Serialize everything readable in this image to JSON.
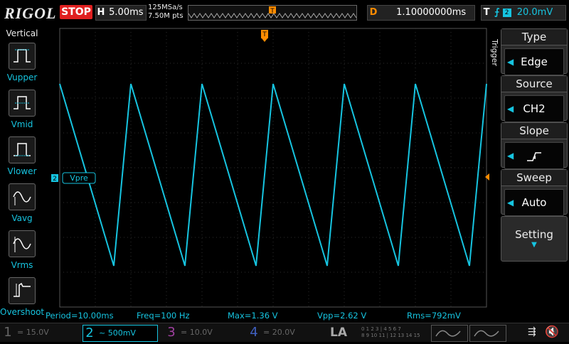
{
  "brand": "RIGOL",
  "run_state": "STOP",
  "timebase": {
    "prefix": "H",
    "value": "5.00ms"
  },
  "acquisition": {
    "sample_rate": "125MSa/s",
    "memory_depth": "7.50M pts"
  },
  "memory_bar": {
    "trigger_marker": "T"
  },
  "delay": {
    "prefix": "D",
    "value": "1.10000000ms"
  },
  "trigger_info": {
    "prefix": "T",
    "slope_symbol": "⨍",
    "channel": "2",
    "level": "20.0mV"
  },
  "left_menu": {
    "title": "Vertical",
    "items": [
      {
        "label": "Vupper",
        "icon": "vupper-icon"
      },
      {
        "label": "Vmid",
        "icon": "vmid-icon"
      },
      {
        "label": "Vlower",
        "icon": "vlower-icon"
      },
      {
        "label": "Vavg",
        "icon": "vavg-icon"
      },
      {
        "label": "Vrms",
        "icon": "vrms-icon"
      },
      {
        "label": "Overshoot",
        "icon": "overshoot-icon"
      }
    ]
  },
  "grid": {
    "trigger_marker": "T",
    "channel_marker": "2",
    "cursor_label": "Vpre",
    "waveform": {
      "channel": 2,
      "shape": "sawtooth-falling",
      "periods_visible": 6,
      "color": "#16c4e0"
    }
  },
  "right_menu": {
    "side_title": "Trigger",
    "blocks": [
      {
        "title": "Type",
        "value": "Edge"
      },
      {
        "title": "Source",
        "value": "CH2"
      },
      {
        "title": "Slope",
        "value": "rising-edge-icon"
      },
      {
        "title": "Sweep",
        "value": "Auto"
      },
      {
        "title": "Setting",
        "value": "▼"
      }
    ]
  },
  "measurements": [
    {
      "label": "Period=10.00ms"
    },
    {
      "label": "Freq=100 Hz"
    },
    {
      "label": "Max=1.36 V"
    },
    {
      "label": "Vpp=2.62 V"
    },
    {
      "label": "Rms=792mV"
    }
  ],
  "channels": [
    {
      "num": "1",
      "scale": "15.0V",
      "coupling": "=",
      "active": false,
      "color": "#e8e800"
    },
    {
      "num": "2",
      "scale": "500mV",
      "coupling": "~",
      "active": true,
      "color": "#16c4e0"
    },
    {
      "num": "3",
      "scale": "10.0V",
      "coupling": "=",
      "active": false,
      "color": "#e040e0"
    },
    {
      "num": "4",
      "scale": "20.0V",
      "coupling": "=",
      "active": false,
      "color": "#4070ff"
    }
  ],
  "la_label": "LA",
  "la_bits": [
    "0 1 2 3",
    "4 5 6 7",
    "8 9 10 11",
    "12 13 14 15"
  ],
  "colors": {
    "accent": "#16c4e0",
    "stop": "#e02020",
    "trigger": "#ff8c00"
  }
}
